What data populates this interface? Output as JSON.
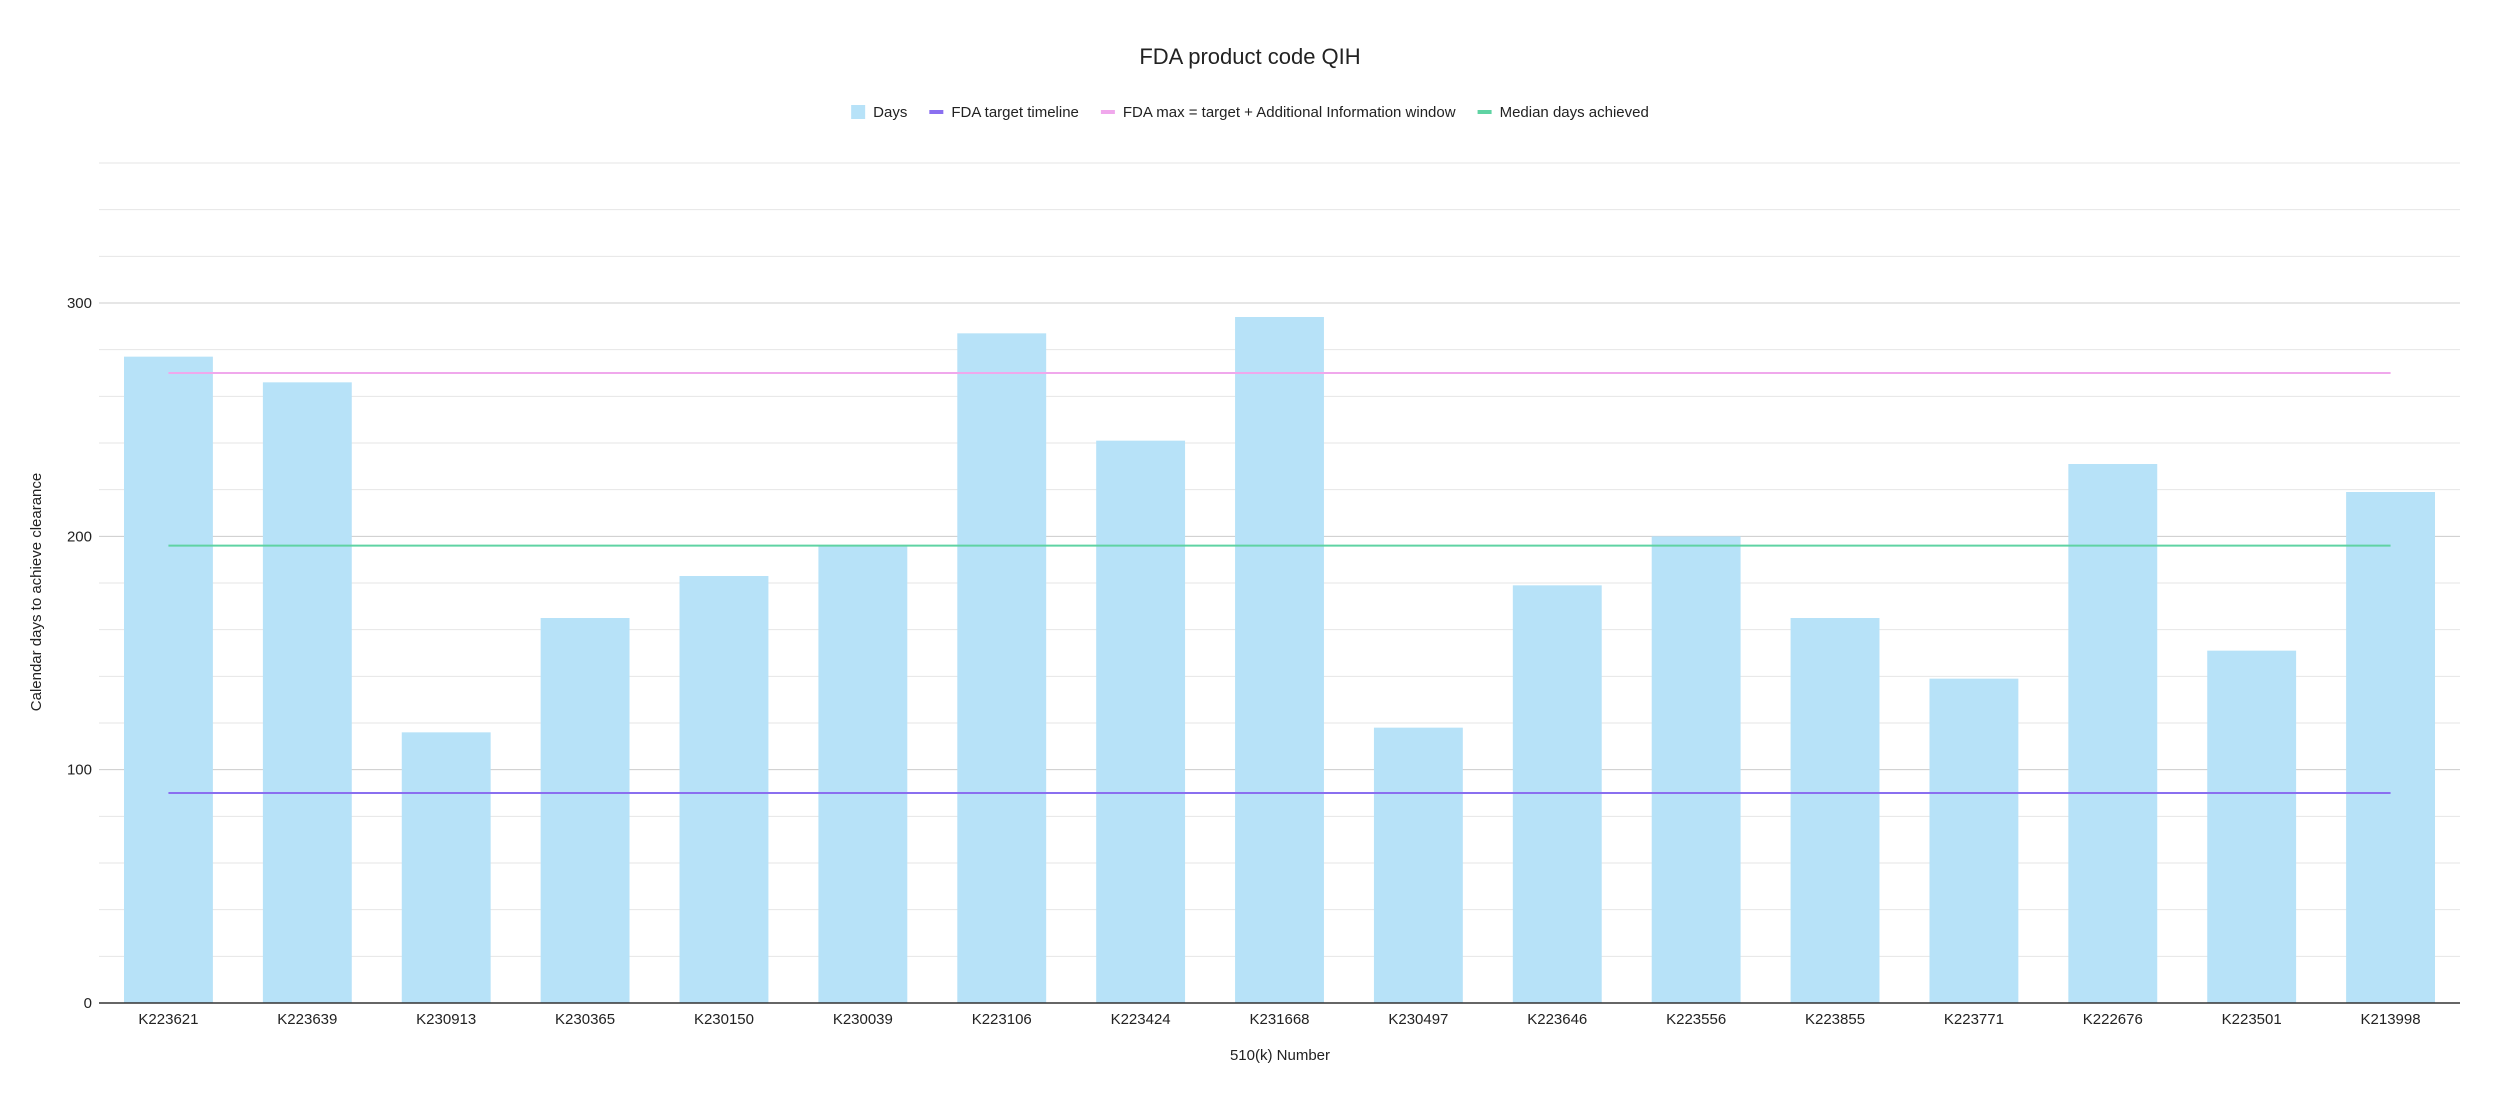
{
  "chart_data": {
    "type": "bar",
    "title": "FDA product code QIH",
    "xlabel": "510(k) Number",
    "ylabel": "Calendar days to achieve clearance",
    "ylim": [
      0,
      360
    ],
    "yticks": [
      0,
      100,
      200,
      300
    ],
    "grid": true,
    "legend_position": "top",
    "categories": [
      "K223621",
      "K223639",
      "K230913",
      "K230365",
      "K230150",
      "K230039",
      "K223106",
      "K223424",
      "K231668",
      "K230497",
      "K223646",
      "K223556",
      "K223855",
      "K223771",
      "K222676",
      "K223501",
      "K213998"
    ],
    "series": [
      {
        "name": "Days",
        "type": "bar",
        "color": "#b7e2f8",
        "values": [
          277,
          266,
          116,
          165,
          183,
          196,
          287,
          241,
          294,
          118,
          179,
          200,
          165,
          139,
          231,
          151,
          219
        ]
      },
      {
        "name": "FDA target timeline",
        "type": "line",
        "color": "#8a6ff0",
        "value": 90
      },
      {
        "name": "FDA max = target + Additional Information window",
        "type": "line",
        "color": "#f0a8ec",
        "value": 270
      },
      {
        "name": "Median days achieved",
        "type": "line",
        "color": "#5fd3a3",
        "value": 196
      }
    ]
  }
}
